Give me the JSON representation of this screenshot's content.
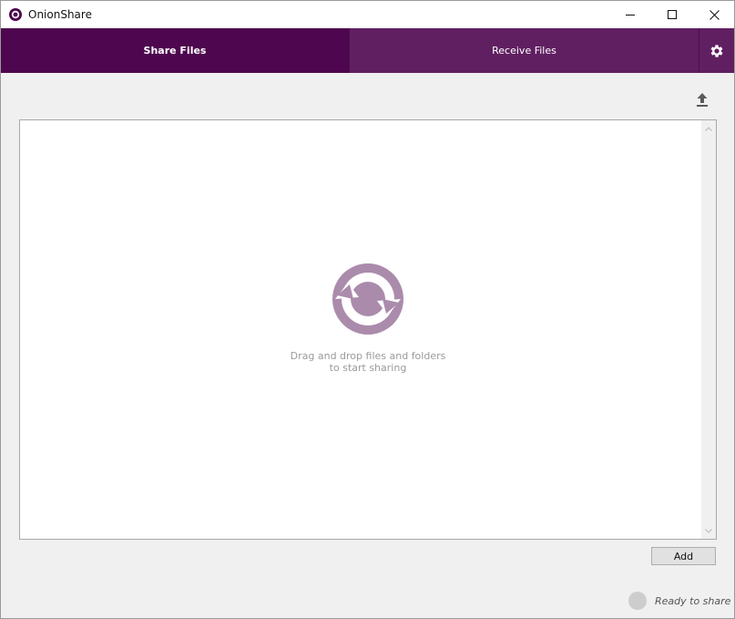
{
  "window": {
    "title": "OnionShare",
    "controls": {
      "minimize_icon": "minimize-icon",
      "maximize_icon": "maximize-icon",
      "close_icon": "close-icon"
    }
  },
  "tabs": [
    {
      "label": "Share Files",
      "active": true
    },
    {
      "label": "Receive Files",
      "active": false
    }
  ],
  "settings_icon": "gear-icon",
  "upload_icon": "upload-icon",
  "drop_area": {
    "line1": "Drag and drop files and folders",
    "line2": "to start sharing"
  },
  "add_button": {
    "label": "Add"
  },
  "status": {
    "text": "Ready to share"
  },
  "colors": {
    "tab_active": "#4e064e",
    "tab_inactive": "#601f61",
    "logo": "#ab8bab"
  }
}
